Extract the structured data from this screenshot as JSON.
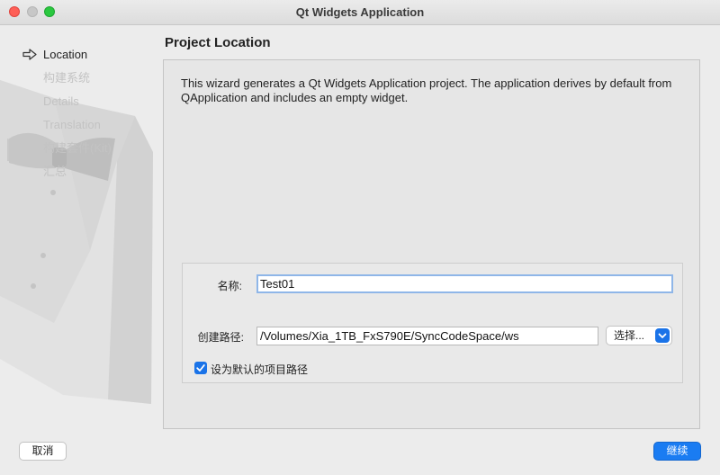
{
  "window": {
    "title": "Qt Widgets Application"
  },
  "steps": [
    {
      "label": "Location",
      "active": true
    },
    {
      "label": "构建系统",
      "active": false
    },
    {
      "label": "Details",
      "active": false
    },
    {
      "label": "Translation",
      "active": false
    },
    {
      "label": "构建套件(Kit)",
      "active": false
    },
    {
      "label": "汇总",
      "active": false
    }
  ],
  "page": {
    "title": "Project Location",
    "description": "This wizard generates a Qt Widgets Application project. The application derives by default from QApplication and includes an empty widget."
  },
  "form": {
    "name_label": "名称:",
    "name_value": "Test01",
    "path_label": "创建路径:",
    "path_value": "/Volumes/Xia_1TB_FxS790E/SyncCodeSpace/ws",
    "choose_label": "选择...",
    "default_path_label": "设为默认的项目路径",
    "default_path_checked": true
  },
  "buttons": {
    "cancel": "取消",
    "next": "继续"
  },
  "colors": {
    "accent": "#1a7cf2"
  }
}
